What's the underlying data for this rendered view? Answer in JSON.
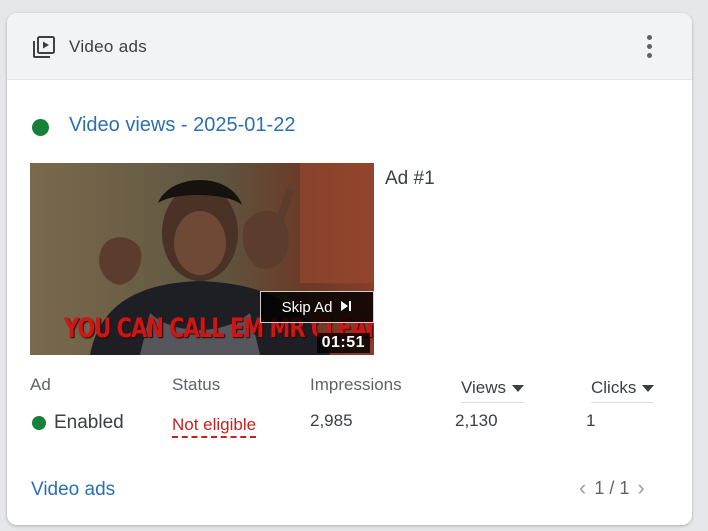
{
  "card": {
    "title": "Video ads",
    "title_icon": "video-library-icon",
    "menu_icon": "more-vert-icon"
  },
  "ad_group": {
    "status_color": "#188038",
    "name": "Video views - 2025-01-22"
  },
  "ad": {
    "label": "Ad #1",
    "thumbnail": {
      "caption": "YOU CAN CALL EM MR CLEAN",
      "skip_label": "Skip Ad",
      "skip_icon": "skip-next-icon",
      "duration": "01:51"
    }
  },
  "table": {
    "columns": {
      "ad": "Ad",
      "status": "Status",
      "impressions": "Impressions",
      "views": "Views",
      "clicks": "Clicks"
    },
    "row": {
      "ad": "Enabled",
      "status": "Not eligible",
      "impressions": "2,985",
      "views": "2,130",
      "clicks": "1"
    }
  },
  "footer": {
    "link": "Video ads",
    "pagination": "1 / 1",
    "prev_icon": "chevron-left-icon",
    "next_icon": "chevron-right-icon"
  },
  "colors": {
    "link": "#2b6fb5",
    "enabled": "#188038",
    "error": "#c5221f"
  }
}
